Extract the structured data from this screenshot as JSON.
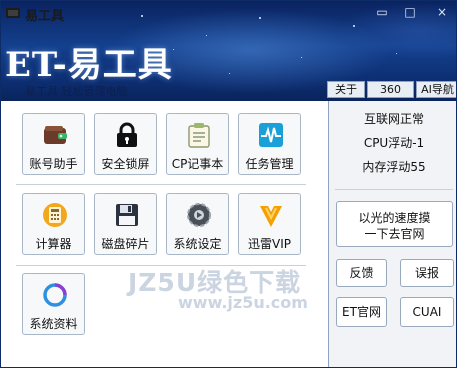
{
  "window": {
    "title": "易工具",
    "controls": [
      "▭",
      "□",
      "×"
    ]
  },
  "header": {
    "brand": "ET-易工具",
    "slogan": "易工具   轻松管理电脑",
    "tabs": [
      "关于",
      "360",
      "AI导航"
    ]
  },
  "tools": [
    {
      "label": "账号助手",
      "icon": "wallet-icon"
    },
    {
      "label": "安全锁屏",
      "icon": "lock-icon"
    },
    {
      "label": "CP记事本",
      "icon": "notepad-icon"
    },
    {
      "label": "任务管理",
      "icon": "pulse-icon"
    },
    {
      "label": "计算器",
      "icon": "calculator-icon"
    },
    {
      "label": "磁盘碎片",
      "icon": "floppy-disk-icon"
    },
    {
      "label": "系统设定",
      "icon": "gear-icon"
    },
    {
      "label": "迅雷VIP",
      "icon": "thunder-icon"
    },
    {
      "label": "系统资料",
      "icon": "ring-icon"
    }
  ],
  "status": {
    "network": "互联网正常",
    "cpu": "CPU浮动-1",
    "memory": "内存浮动55"
  },
  "actions": {
    "speed_button_line1": "以光的速度摸",
    "speed_button_line2": "一下去官网",
    "feedback": "反馈",
    "report": "误报",
    "et_site": "ET官网",
    "cuai": "CUAI"
  },
  "watermark": {
    "text": "JZ5U绿色下载",
    "url": "www.jz5u.com"
  },
  "colors": {
    "header_dark": "#0a2360",
    "header_mid": "#14408e",
    "accent_teal": "#1aa0d8",
    "thunder_orange": "#f5a000",
    "ring_blue": "#2f8fe0"
  }
}
